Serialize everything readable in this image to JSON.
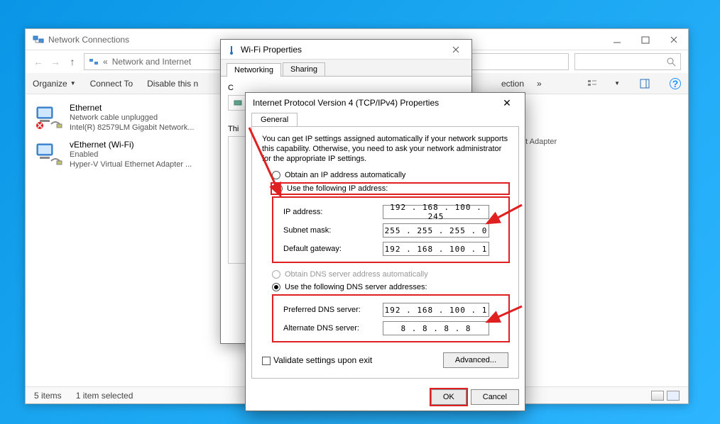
{
  "nc": {
    "window_title": "Network Connections",
    "breadcrumb_prefix": "«",
    "breadcrumb": "Network and Internet",
    "toolbar": {
      "organize": "Organize",
      "connect_to": "Connect To",
      "disable": "Disable this n",
      "diag": "ection",
      "more": "»"
    },
    "adapters": [
      {
        "name": "Ethernet",
        "status": "Network cable unplugged",
        "device": "Intel(R) 82579LM Gigabit Network..."
      },
      {
        "name": "vEthernet (Wi-Fi)",
        "status": "Enabled",
        "device": "Hyper-V Virtual Ethernet Adapter ..."
      }
    ],
    "hidden_adapter_suffix": "et Adapter",
    "status_items": "5 items",
    "status_selected": "1 item selected"
  },
  "wifi": {
    "title": "Wi-Fi Properties",
    "tab_networking": "Networking",
    "tab_sharing": "Sharing",
    "connect_using_label": "C",
    "this_text": "Thi"
  },
  "ipv4": {
    "title": "Internet Protocol Version 4 (TCP/IPv4) Properties",
    "tab_general": "General",
    "description": "You can get IP settings assigned automatically if your network supports this capability. Otherwise, you need to ask your network administrator for the appropriate IP settings.",
    "radio_obtain_ip": "Obtain an IP address automatically",
    "radio_use_ip": "Use the following IP address:",
    "label_ip": "IP address:",
    "label_subnet": "Subnet mask:",
    "label_gateway": "Default gateway:",
    "radio_obtain_dns": "Obtain DNS server address automatically",
    "radio_use_dns": "Use the following DNS server addresses:",
    "label_pref_dns": "Preferred DNS server:",
    "label_alt_dns": "Alternate DNS server:",
    "validate_label": "Validate settings upon exit",
    "btn_advanced": "Advanced...",
    "btn_ok": "OK",
    "btn_cancel": "Cancel",
    "values": {
      "ip": "192 . 168 . 100 . 245",
      "subnet": "255 . 255 . 255 .  0",
      "gateway": "192 . 168 . 100 .  1",
      "pref_dns": "192 . 168 . 100 .  1",
      "alt_dns": "8  .  8  .  8  .  8"
    }
  },
  "annotation_color": "#e02020"
}
